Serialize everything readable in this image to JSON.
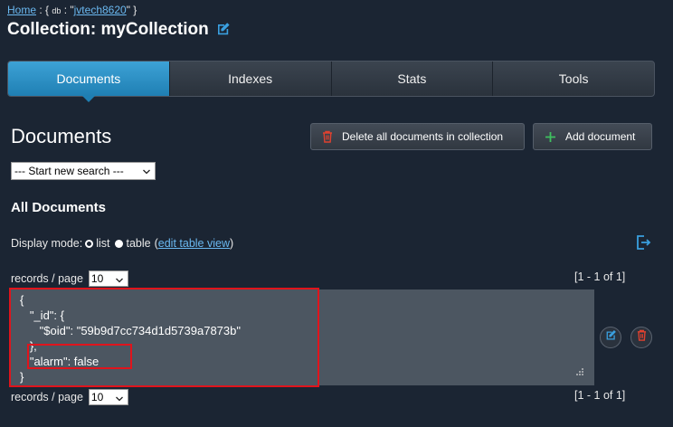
{
  "breadcrumb": {
    "home": "Home",
    "sep1": " : { ",
    "db_label": "db",
    "sep2": " : \"",
    "db_name": "jvtech8620",
    "sep3": "\" }"
  },
  "page_title": "Collection: myCollection",
  "tabs": [
    {
      "label": "Documents",
      "active": true
    },
    {
      "label": "Indexes"
    },
    {
      "label": "Stats"
    },
    {
      "label": "Tools"
    }
  ],
  "documents_heading": "Documents",
  "actions": {
    "delete_all": "Delete all documents in collection",
    "add_document": "Add document"
  },
  "search": {
    "selected": "--- Start new search ---"
  },
  "all_documents_heading": "All Documents",
  "display_mode": {
    "label": "Display mode:",
    "list": "list",
    "table": "table",
    "open": "(",
    "edit_link": "edit table view",
    "close": ")"
  },
  "pagination": {
    "label": "records / page",
    "per_page": "10",
    "range": "[1 - 1 of 1]"
  },
  "document": {
    "json": "{\n   \"_id\": {\n      \"$oid\": \"59b9d7cc734d1d5739a7873b\"\n   },\n   \"alarm\": false\n}"
  },
  "colors": {
    "accent": "#2b8fc6",
    "highlight": "#e0141c",
    "delete_icon": "#e0412f",
    "add_icon": "#3fbf5f"
  },
  "icons": {
    "title": "edit-icon",
    "delete_all": "trash-icon",
    "add": "plus-icon",
    "export": "export-icon",
    "edit_doc": "edit-icon",
    "delete_doc": "trash-icon"
  }
}
